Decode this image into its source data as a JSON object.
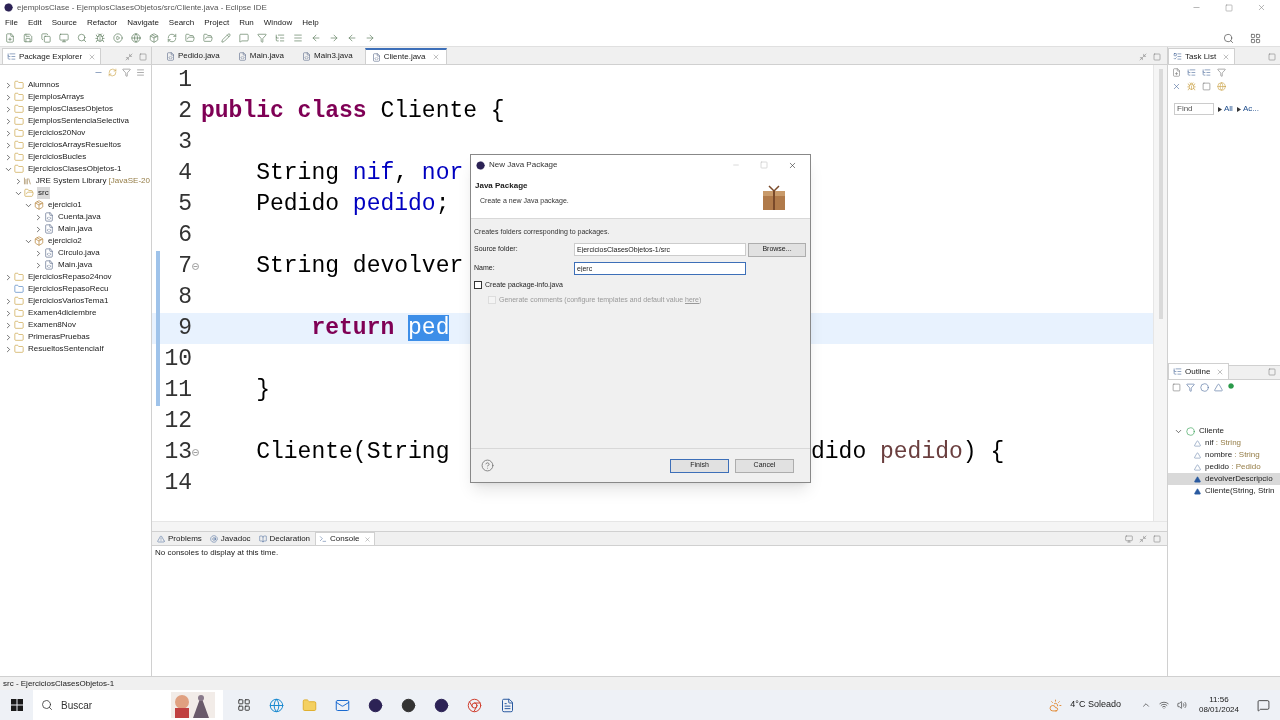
{
  "window": {
    "title": "ejemplosClase - EjemplosClasesObjetos/src/Cliente.java - Eclipse IDE"
  },
  "menu": [
    "File",
    "Edit",
    "Source",
    "Refactor",
    "Navigate",
    "Search",
    "Project",
    "Run",
    "Window",
    "Help"
  ],
  "package_explorer": {
    "tab": {
      "label": "Package Explorer",
      "selected": true
    },
    "items": [
      {
        "label": "Alumnos",
        "kind": "project",
        "expanded": false,
        "selected": false
      },
      {
        "label": "EjemplosArrays",
        "kind": "project",
        "expanded": false,
        "selected": false
      },
      {
        "label": "EjemplosClasesObjetos",
        "kind": "project",
        "expanded": false,
        "selected": false
      },
      {
        "label": "EjemplosSentenciaSelectiva",
        "kind": "project",
        "expanded": false,
        "selected": false
      },
      {
        "label": "Ejercicios20Nov",
        "kind": "project",
        "expanded": false,
        "selected": false
      },
      {
        "label": "EjerciciosArraysResueltos",
        "kind": "project",
        "expanded": false,
        "selected": false
      },
      {
        "label": "EjerciciosBucles",
        "kind": "project",
        "expanded": false,
        "selected": false
      },
      {
        "label": "EjerciciosClasesObjetos-1",
        "kind": "project",
        "expanded": true,
        "selected": false,
        "children": [
          {
            "label": "JRE System Library",
            "decoration": "[JavaSE-20",
            "kind": "library",
            "expanded": false,
            "selected": false
          },
          {
            "label": "src",
            "kind": "folder",
            "expanded": true,
            "selected": true,
            "children": [
              {
                "label": "ejercicio1",
                "kind": "package",
                "expanded": true,
                "selected": false,
                "children": [
                  {
                    "label": "Cuenta.java",
                    "kind": "file",
                    "expanded": false,
                    "selected": false
                  },
                  {
                    "label": "Main.java",
                    "kind": "file",
                    "expanded": false,
                    "selected": false
                  }
                ]
              },
              {
                "label": "ejercicio2",
                "kind": "package",
                "expanded": true,
                "selected": false,
                "children": [
                  {
                    "label": "Circulo.java",
                    "kind": "file",
                    "expanded": false,
                    "selected": false
                  },
                  {
                    "label": "Main.java",
                    "kind": "file",
                    "expanded": false,
                    "selected": false
                  }
                ]
              }
            ]
          }
        ]
      },
      {
        "label": "EjerciciosRepaso24nov",
        "kind": "project",
        "expanded": false,
        "selected": false
      },
      {
        "label": "EjerciciosRepasoRecu",
        "kind": "closed_project",
        "selected": false
      },
      {
        "label": "EjerciciosVariosTema1",
        "kind": "project",
        "expanded": false,
        "selected": false
      },
      {
        "label": "Examen4diciembre",
        "kind": "project",
        "expanded": false,
        "selected": false
      },
      {
        "label": "Examen8Nov",
        "kind": "project",
        "expanded": false,
        "selected": false
      },
      {
        "label": "PrimerasPruebas",
        "kind": "project",
        "expanded": false,
        "selected": false
      },
      {
        "label": "ResueltosSentenciaIf",
        "kind": "project",
        "expanded": false,
        "selected": false
      }
    ]
  },
  "editor": {
    "tabs": [
      {
        "label": "Pedido.java",
        "selected": false
      },
      {
        "label": "Main.java",
        "selected": false
      },
      {
        "label": "Main3.java",
        "selected": false
      },
      {
        "label": "Cliente.java",
        "selected": true
      }
    ],
    "lines": [
      {
        "number": "1",
        "foldable": false,
        "marked": false,
        "current": false
      },
      {
        "number": "2",
        "foldable": false,
        "marked": false,
        "current": false,
        "segments": [
          {
            "text": "public class",
            "kind": "keyword"
          },
          {
            "text": " Cliente {",
            "kind": "plain"
          }
        ]
      },
      {
        "number": "3",
        "foldable": false,
        "marked": false,
        "current": false
      },
      {
        "number": "4",
        "foldable": false,
        "marked": false,
        "current": false,
        "segments": [
          {
            "text": "    String ",
            "kind": "plain"
          },
          {
            "text": "nif",
            "kind": "field"
          },
          {
            "text": ", ",
            "kind": "plain"
          },
          {
            "text": "nor",
            "kind": "field"
          }
        ]
      },
      {
        "number": "5",
        "foldable": false,
        "marked": false,
        "current": false,
        "segments": [
          {
            "text": "    Pedido ",
            "kind": "plain"
          },
          {
            "text": "pedido",
            "kind": "field"
          },
          {
            "text": ";",
            "kind": "plain"
          }
        ]
      },
      {
        "number": "6",
        "foldable": false,
        "marked": false,
        "current": false
      },
      {
        "number": "7",
        "foldable": true,
        "marked": true,
        "current": false,
        "segments": [
          {
            "text": "    String devolver",
            "kind": "plain"
          }
        ]
      },
      {
        "number": "8",
        "foldable": false,
        "marked": true,
        "current": false
      },
      {
        "number": "9",
        "foldable": false,
        "marked": true,
        "current": true,
        "segments": [
          {
            "text": "        return ",
            "kind": "keyword"
          },
          {
            "text": "ped",
            "kind": "selected"
          }
        ]
      },
      {
        "number": "10",
        "foldable": false,
        "marked": true,
        "current": false
      },
      {
        "number": "11",
        "foldable": false,
        "marked": true,
        "current": false,
        "segments": [
          {
            "text": "    }",
            "kind": "plain"
          }
        ]
      },
      {
        "number": "12",
        "foldable": false,
        "marked": false,
        "current": false
      },
      {
        "number": "13",
        "foldable": true,
        "marked": false,
        "current": false,
        "segments": [
          {
            "text": "    Cliente(String",
            "kind": "plain"
          }
        ],
        "after": [
          {
            "text": "dido ",
            "kind": "plain"
          },
          {
            "text": "pedido",
            "kind": "param"
          },
          {
            "text": ") {",
            "kind": "plain"
          }
        ]
      },
      {
        "number": "14",
        "foldable": false,
        "marked": false,
        "current": false
      }
    ]
  },
  "console": {
    "tabs": [
      {
        "label": "Problems",
        "selected": false
      },
      {
        "label": "Javadoc",
        "selected": false
      },
      {
        "label": "Declaration",
        "selected": false
      },
      {
        "label": "Console",
        "selected": true
      }
    ],
    "message": "No consoles to display at this time."
  },
  "task_list": {
    "tab": {
      "label": "Task List",
      "selected": true
    },
    "find": {
      "placeholder": "Find"
    },
    "filters": [
      "All",
      "Ac..."
    ]
  },
  "outline": {
    "tab": {
      "label": "Outline",
      "selected": true
    },
    "root": {
      "name": "Cliente",
      "expanded": true,
      "selected": false
    },
    "members": [
      {
        "name": "nif",
        "type": ": String",
        "kind": "field",
        "selected": false
      },
      {
        "name": "nombre",
        "type": ": String",
        "kind": "field",
        "selected": false
      },
      {
        "name": "pedido",
        "type": ": Pedido",
        "kind": "field",
        "selected": false
      },
      {
        "name": "devolverDescripcio",
        "kind": "method",
        "selected": true
      },
      {
        "name": "Cliente(String, Strin",
        "kind": "constructor",
        "selected": false
      }
    ]
  },
  "dialog": {
    "title": "New Java Package",
    "heading": "Java Package",
    "subheading": "Create a new Java package.",
    "description": "Creates folders corresponding to packages.",
    "fields": [
      {
        "label": "Source folder:",
        "value": "EjerciciosClasesObjetos-1/src",
        "focused": false
      },
      {
        "label": "Name:",
        "value": "ejerc",
        "focused": true
      }
    ],
    "browse_button": "Browse...",
    "checkboxes": [
      {
        "label": "Create package-info.java",
        "checked": false,
        "disabled": false
      },
      {
        "label": "Generate comments (configure templates and default value ",
        "link": "here",
        "label_end": ")",
        "checked": false,
        "disabled": true
      }
    ],
    "buttons": [
      {
        "label": "Finish",
        "default": true
      },
      {
        "label": "Cancel",
        "default": false
      }
    ]
  },
  "status_bar": "src - EjerciciosClasesObjetos-1",
  "taskbar": {
    "search": {
      "placeholder": "Buscar"
    },
    "weather": "4°C Soleado",
    "time": "11:56",
    "date": "08/01/2024"
  }
}
